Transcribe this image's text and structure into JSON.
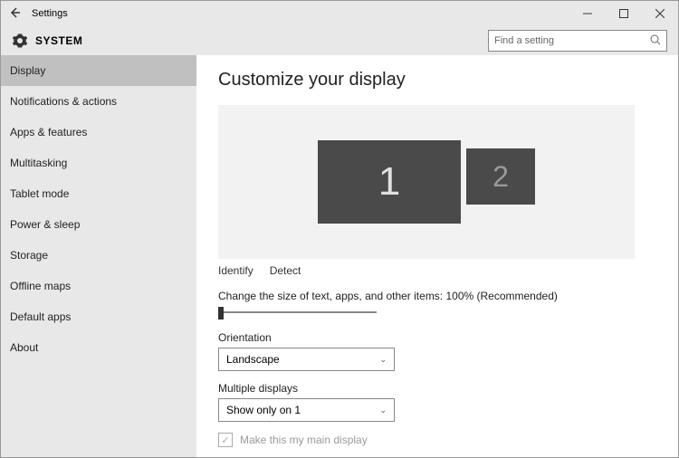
{
  "titlebar": {
    "app_name": "Settings"
  },
  "header": {
    "section": "SYSTEM",
    "search_placeholder": "Find a setting"
  },
  "sidebar": {
    "items": [
      {
        "label": "Display",
        "active": true
      },
      {
        "label": "Notifications & actions"
      },
      {
        "label": "Apps & features"
      },
      {
        "label": "Multitasking"
      },
      {
        "label": "Tablet mode"
      },
      {
        "label": "Power & sleep"
      },
      {
        "label": "Storage"
      },
      {
        "label": "Offline maps"
      },
      {
        "label": "Default apps"
      },
      {
        "label": "About"
      }
    ]
  },
  "main": {
    "title": "Customize your display",
    "monitors": {
      "m1": "1",
      "m2": "2"
    },
    "links": {
      "identify": "Identify",
      "detect": "Detect"
    },
    "scale_label": "Change the size of text, apps, and other items: 100% (Recommended)",
    "orientation": {
      "label": "Orientation",
      "value": "Landscape"
    },
    "multiple": {
      "label": "Multiple displays",
      "value": "Show only on 1"
    },
    "main_display_checkbox": "Make this my main display"
  }
}
